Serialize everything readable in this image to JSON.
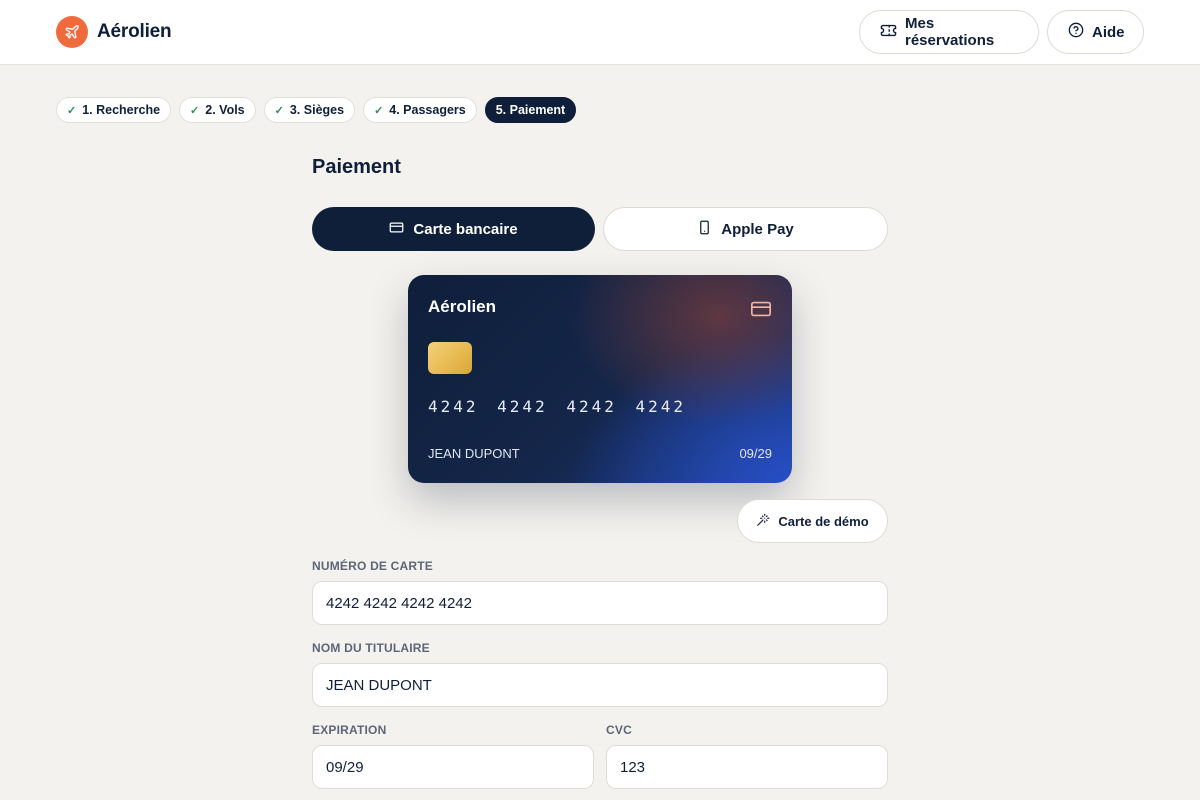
{
  "header": {
    "brand": "Aérolien",
    "reservations_label": "Mes réservations",
    "help_label": "Aide"
  },
  "steps": [
    {
      "label": "1. Recherche",
      "done": true
    },
    {
      "label": "2. Vols",
      "done": true
    },
    {
      "label": "3. Sièges",
      "done": true
    },
    {
      "label": "4. Passagers",
      "done": true
    },
    {
      "label": "5. Paiement",
      "active": true
    }
  ],
  "payment": {
    "title": "Paiement",
    "tabs": {
      "card": "Carte bancaire",
      "apple": "Apple Pay"
    },
    "card_preview": {
      "brand": "Aérolien",
      "number": "4242 4242 4242 4242",
      "holder": "JEAN DUPONT",
      "expiry": "09/29"
    },
    "demo_button": "Carte de démo",
    "fields": {
      "card_number": {
        "label": "NUMÉRO DE CARTE",
        "value": "4242 4242 4242 4242"
      },
      "holder": {
        "label": "NOM DU TITULAIRE",
        "value": "JEAN DUPONT"
      },
      "expiration": {
        "label": "EXPIRATION",
        "value": "09/29"
      },
      "cvc": {
        "label": "CVC",
        "value": "123"
      }
    }
  },
  "colors": {
    "accent": "#f06b3c",
    "primary": "#0f1f3a",
    "background": "#f4f2ee"
  }
}
